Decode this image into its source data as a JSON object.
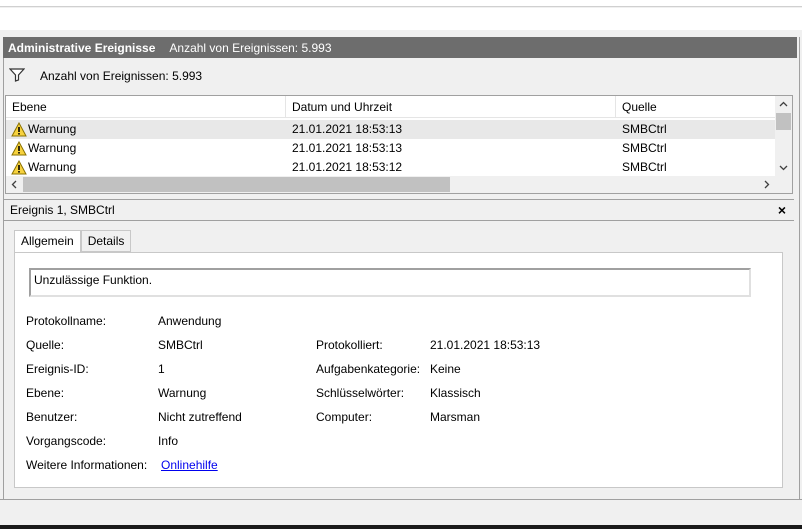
{
  "header": {
    "title": "Administrative Ereignisse",
    "count_label": "Anzahl von Ereignissen: 5.993"
  },
  "filter": {
    "text": "Anzahl von Ereignissen: 5.993",
    "icon": "filter-icon"
  },
  "grid": {
    "columns": [
      "Ebene",
      "Datum und Uhrzeit",
      "Quelle"
    ],
    "rows": [
      {
        "level": "Warnung",
        "datetime": "21.01.2021 18:53:13",
        "source": "SMBCtrl",
        "icon": "warning-icon"
      },
      {
        "level": "Warnung",
        "datetime": "21.01.2021 18:53:13",
        "source": "SMBCtrl",
        "icon": "warning-icon"
      },
      {
        "level": "Warnung",
        "datetime": "21.01.2021 18:53:12",
        "source": "SMBCtrl",
        "icon": "warning-icon"
      }
    ]
  },
  "detail": {
    "title": "Ereignis 1, SMBCtrl",
    "close_label": "×",
    "tabs": [
      "Allgemein",
      "Details"
    ],
    "message": "Unzulässige Funktion.",
    "fields": {
      "logname_label": "Protokollname:",
      "logname_value": "Anwendung",
      "source_label": "Quelle:",
      "source_value": "SMBCtrl",
      "logged_label": "Protokolliert:",
      "logged_value": "21.01.2021 18:53:13",
      "eventid_label": "Ereignis-ID:",
      "eventid_value": "1",
      "taskcat_label": "Aufgabenkategorie:",
      "taskcat_value": "Keine",
      "level_label": "Ebene:",
      "level_value": "Warnung",
      "keywords_label": "Schlüsselwörter:",
      "keywords_value": "Klassisch",
      "user_label": "Benutzer:",
      "user_value": "Nicht zutreffend",
      "computer_label": "Computer:",
      "computer_value": "Marsman",
      "opcode_label": "Vorgangscode:",
      "opcode_value": "Info",
      "moreinfo_label": "Weitere Informationen:",
      "moreinfo_link": "Onlinehilfe"
    }
  },
  "colors": {
    "title_bar": "#6d6d6d",
    "selected_row": "#e8e8e8",
    "link": "#0000ee",
    "warning_fill": "#f7d23e"
  }
}
